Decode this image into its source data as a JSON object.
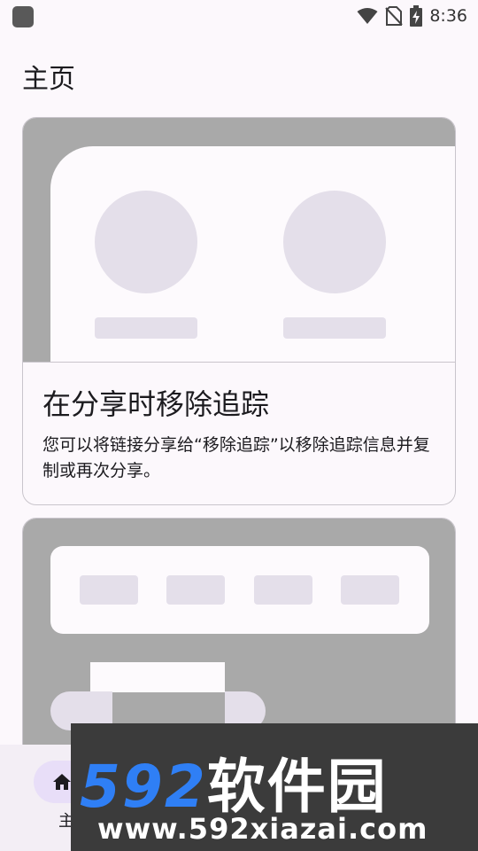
{
  "status_bar": {
    "time": "8:36"
  },
  "page": {
    "title": "主页"
  },
  "card1": {
    "title": "在分享时移除追踪",
    "description": "您可以将链接分享给“移除追踪”以移除追踪信息并复制或再次分享。"
  },
  "bottom_nav": {
    "home_label": "主页"
  },
  "watermark": {
    "logo_num": "592",
    "logo_cn": "软件园",
    "url": "www.592xiazai.com"
  },
  "colors": {
    "illustration_bg": "#a9a9a9",
    "placeholder": "#e4dfea",
    "nav_indicator": "#e8def8"
  }
}
